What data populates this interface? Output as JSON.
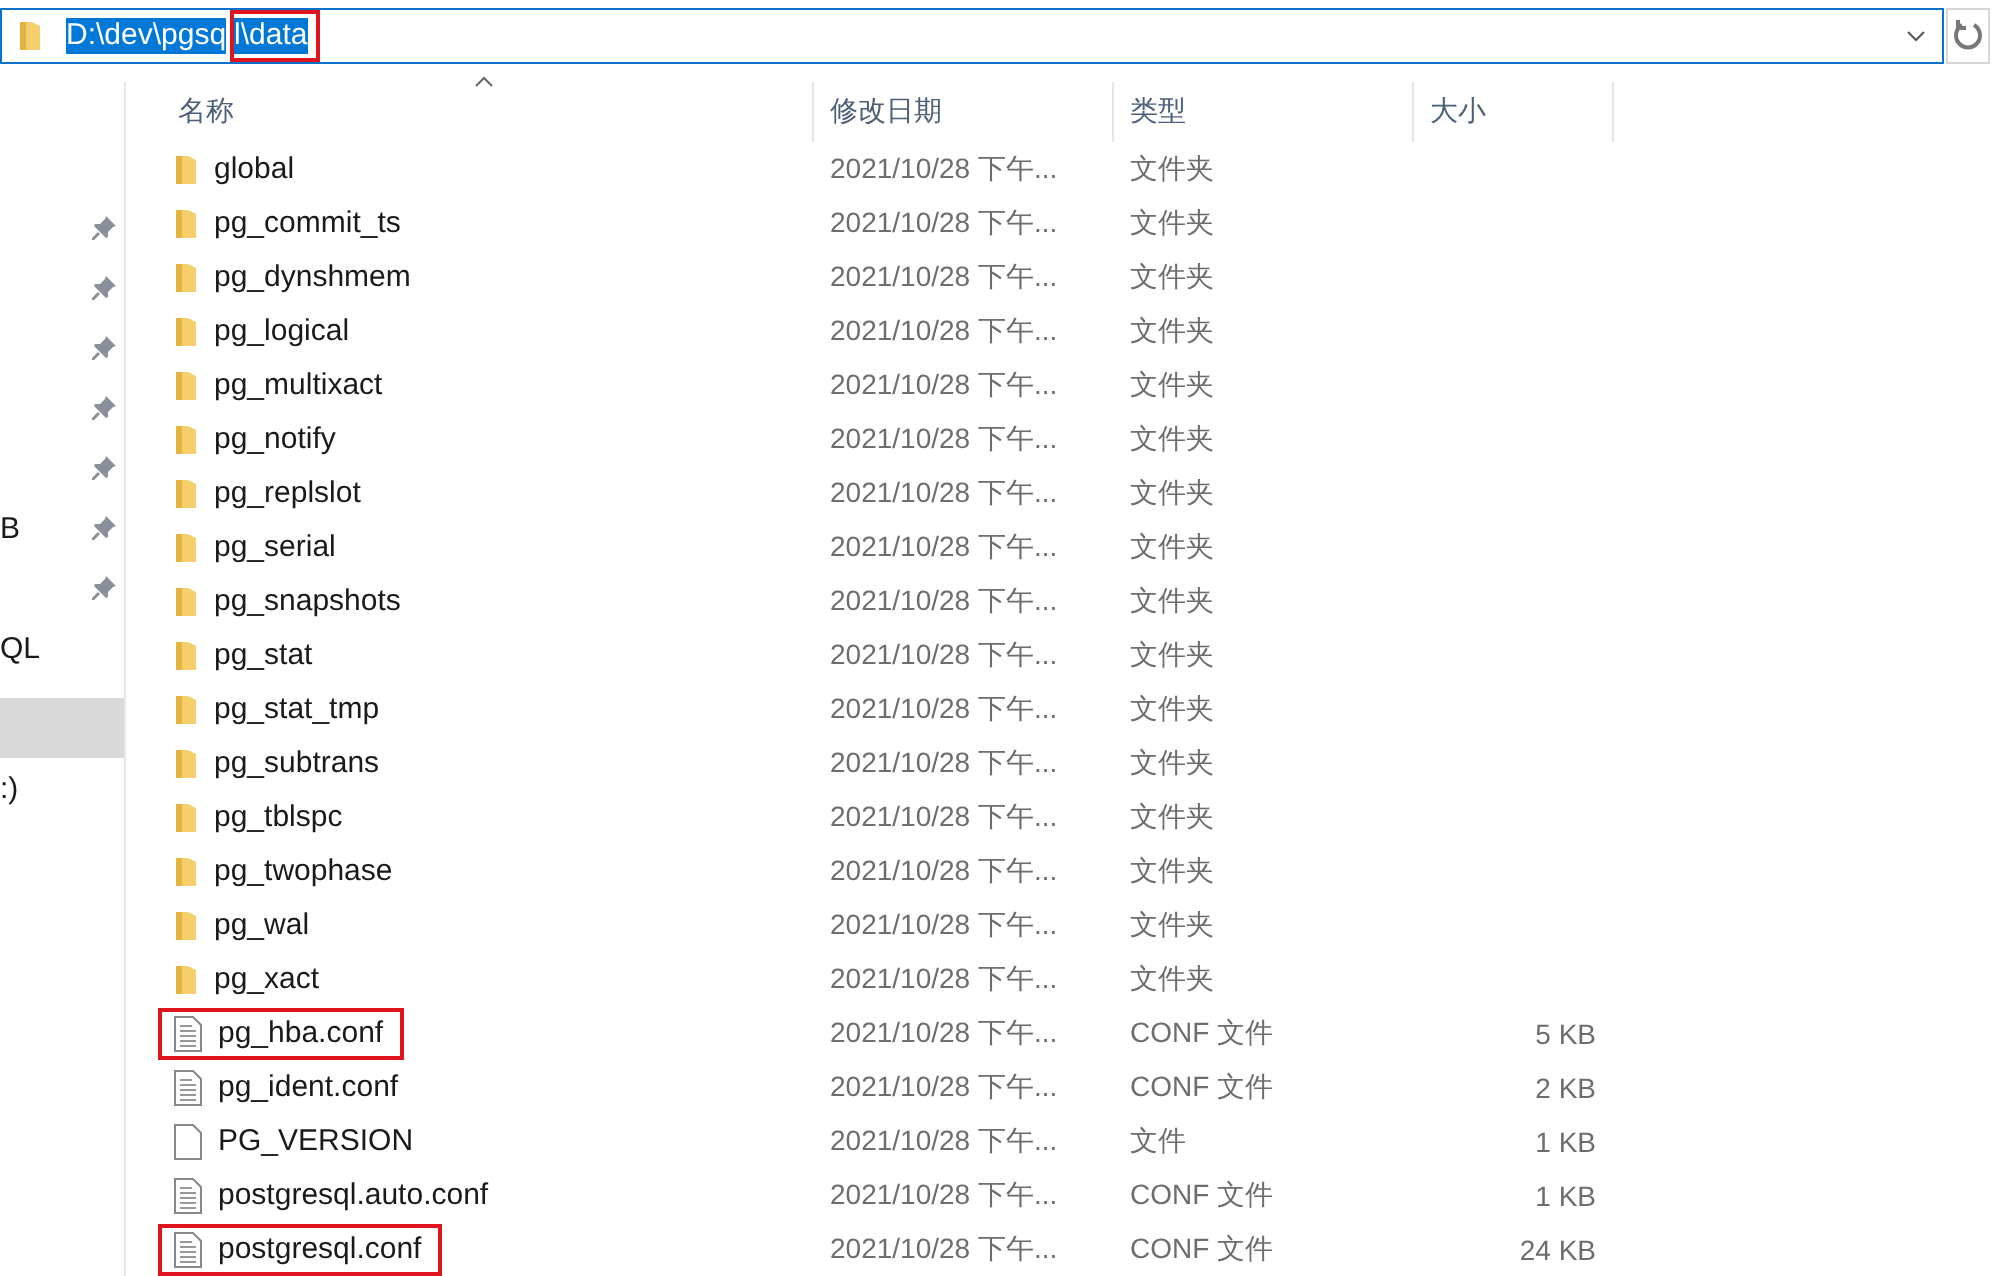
{
  "address_bar": {
    "segments": [
      {
        "text": "D:\\dev\\pgsq",
        "highlighted": false
      },
      {
        "text": "l\\data",
        "highlighted": true
      }
    ],
    "selected": true
  },
  "navigation": {
    "groups": [
      {
        "items": [
          {
            "pinned": true,
            "selected": false
          },
          {
            "pinned": true,
            "selected": false
          },
          {
            "pinned": true,
            "selected": false
          },
          {
            "pinned": true,
            "selected": false
          },
          {
            "pinned": true,
            "selected": false
          },
          {
            "label": "B",
            "pinned": true,
            "selected": false
          },
          {
            "pinned": true,
            "selected": false
          },
          {
            "label": "QL",
            "pinned": false,
            "selected": false
          }
        ]
      },
      {
        "items": [
          {
            "pinned": false,
            "selected": true
          },
          {
            "label": ":)",
            "pinned": false,
            "selected": false
          }
        ]
      }
    ]
  },
  "table": {
    "columns": [
      {
        "label": "名称",
        "sorted": true
      },
      {
        "label": "修改日期",
        "sorted": false
      },
      {
        "label": "类型",
        "sorted": false
      },
      {
        "label": "大小",
        "sorted": false
      }
    ],
    "rows": [
      {
        "kind": "folder",
        "name": "global",
        "modified": "2021/10/28 下午...",
        "type": "文件夹",
        "highlighted": false
      },
      {
        "kind": "folder",
        "name": "pg_commit_ts",
        "modified": "2021/10/28 下午...",
        "type": "文件夹",
        "highlighted": false
      },
      {
        "kind": "folder",
        "name": "pg_dynshmem",
        "modified": "2021/10/28 下午...",
        "type": "文件夹",
        "highlighted": false
      },
      {
        "kind": "folder",
        "name": "pg_logical",
        "modified": "2021/10/28 下午...",
        "type": "文件夹",
        "highlighted": false
      },
      {
        "kind": "folder",
        "name": "pg_multixact",
        "modified": "2021/10/28 下午...",
        "type": "文件夹",
        "highlighted": false
      },
      {
        "kind": "folder",
        "name": "pg_notify",
        "modified": "2021/10/28 下午...",
        "type": "文件夹",
        "highlighted": false
      },
      {
        "kind": "folder",
        "name": "pg_replslot",
        "modified": "2021/10/28 下午...",
        "type": "文件夹",
        "highlighted": false
      },
      {
        "kind": "folder",
        "name": "pg_serial",
        "modified": "2021/10/28 下午...",
        "type": "文件夹",
        "highlighted": false
      },
      {
        "kind": "folder",
        "name": "pg_snapshots",
        "modified": "2021/10/28 下午...",
        "type": "文件夹",
        "highlighted": false
      },
      {
        "kind": "folder",
        "name": "pg_stat",
        "modified": "2021/10/28 下午...",
        "type": "文件夹",
        "highlighted": false
      },
      {
        "kind": "folder",
        "name": "pg_stat_tmp",
        "modified": "2021/10/28 下午...",
        "type": "文件夹",
        "highlighted": false
      },
      {
        "kind": "folder",
        "name": "pg_subtrans",
        "modified": "2021/10/28 下午...",
        "type": "文件夹",
        "highlighted": false
      },
      {
        "kind": "folder",
        "name": "pg_tblspc",
        "modified": "2021/10/28 下午...",
        "type": "文件夹",
        "highlighted": false
      },
      {
        "kind": "folder",
        "name": "pg_twophase",
        "modified": "2021/10/28 下午...",
        "type": "文件夹",
        "highlighted": false
      },
      {
        "kind": "folder",
        "name": "pg_wal",
        "modified": "2021/10/28 下午...",
        "type": "文件夹",
        "highlighted": false
      },
      {
        "kind": "folder",
        "name": "pg_xact",
        "modified": "2021/10/28 下午...",
        "type": "文件夹",
        "highlighted": false
      },
      {
        "kind": "text_file",
        "name": "pg_hba.conf",
        "modified": "2021/10/28 下午...",
        "type": "CONF 文件",
        "size": "5 KB",
        "highlighted": true
      },
      {
        "kind": "text_file",
        "name": "pg_ident.conf",
        "modified": "2021/10/28 下午...",
        "type": "CONF 文件",
        "size": "2 KB",
        "highlighted": false
      },
      {
        "kind": "file",
        "name": "PG_VERSION",
        "modified": "2021/10/28 下午...",
        "type": "文件",
        "size": "1 KB",
        "highlighted": false
      },
      {
        "kind": "text_file",
        "name": "postgresql.auto.conf",
        "modified": "2021/10/28 下午...",
        "type": "CONF 文件",
        "size": "1 KB",
        "highlighted": false
      },
      {
        "kind": "text_file",
        "name": "postgresql.conf",
        "modified": "2021/10/28 下午...",
        "type": "CONF 文件",
        "size": "24 KB",
        "highlighted": true
      }
    ]
  }
}
